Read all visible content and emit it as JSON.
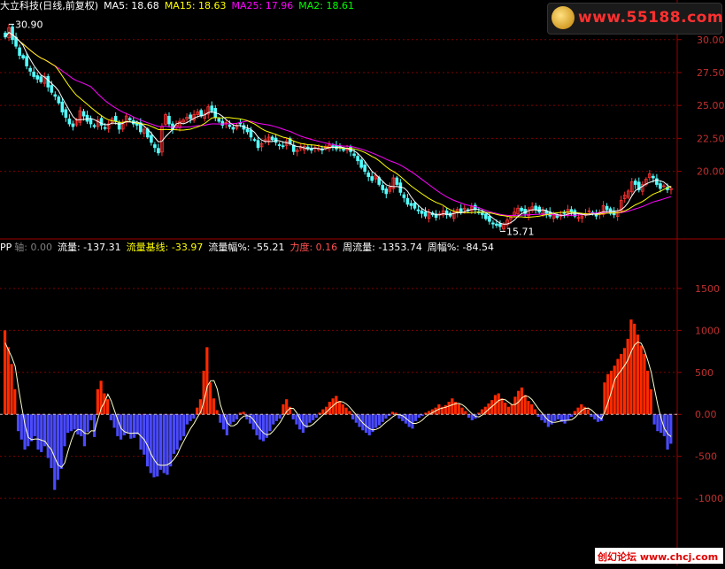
{
  "header_top": {
    "title": "大立科技(日线,前复权)",
    "ma5": "MA5: 18.68",
    "ma15": "MA15: 18.63",
    "ma25": "MA25: 17.96",
    "ma2": "MA2: 18.61"
  },
  "header_bottom": {
    "prefix": "PP",
    "axis": "轴: 0.00",
    "flow": "流量: -137.31",
    "flow_base": "流量基线: -33.97",
    "flow_amp": "流量幅%: -55.21",
    "force": "力度: 0.16",
    "week_flow": "周流量: -1353.74",
    "week_amp": "周幅%: -84.54"
  },
  "watermark_top": "www.55188.com",
  "watermark_bottom": "创幻论坛  www.chcj.com",
  "colors": {
    "up": "#ff3232",
    "down": "#54ffff",
    "ma5": "#ffffff",
    "ma15": "#ffff00",
    "ma25": "#ff00ff",
    "pos_bar": "#ff2a00",
    "neg_bar": "#4a4aff",
    "grid": "#800000",
    "axis_text": "#c03030"
  },
  "chart_data": [
    {
      "type": "candlestick",
      "title": "大立科技(日线,前复权)",
      "ylim": [
        15,
        32
      ],
      "yticks": [
        20.0,
        22.5,
        25.0,
        27.5,
        30.0
      ],
      "annotations": [
        {
          "label": "30.90",
          "value": 30.9
        },
        {
          "label": "15.71",
          "value": 15.71
        }
      ],
      "series": [
        {
          "name": "MA5",
          "last": 18.68
        },
        {
          "name": "MA15",
          "last": 18.63
        },
        {
          "name": "MA25",
          "last": 17.96
        },
        {
          "name": "MA2",
          "last": 18.61
        }
      ],
      "close": [
        30.2,
        30.9,
        30.0,
        29.5,
        28.8,
        28.6,
        28.0,
        27.6,
        27.2,
        27.0,
        26.8,
        27.2,
        26.4,
        26.0,
        25.7,
        25.2,
        24.5,
        24.1,
        23.6,
        23.4,
        23.9,
        24.6,
        24.2,
        23.8,
        23.6,
        23.4,
        23.9,
        23.5,
        23.3,
        23.6,
        24.0,
        23.8,
        23.2,
        23.6,
        24.2,
        23.9,
        23.6,
        23.5,
        23.0,
        23.2,
        22.6,
        22.2,
        21.8,
        21.4,
        23.4,
        24.3,
        23.6,
        23.2,
        23.5,
        23.8,
        23.9,
        24.1,
        24.0,
        24.3,
        24.5,
        24.2,
        24.4,
        24.9,
        24.6,
        24.1,
        23.8,
        23.5,
        23.7,
        23.4,
        23.2,
        23.5,
        23.6,
        23.2,
        23.0,
        22.6,
        22.4,
        21.8,
        22.1,
        22.4,
        22.6,
        22.4,
        22.2,
        22.0,
        21.9,
        22.3,
        22.1,
        21.5,
        21.6,
        21.8,
        21.9,
        21.7,
        21.6,
        21.8,
        21.7,
        21.6,
        21.9,
        22.0,
        21.9,
        21.7,
        21.8,
        21.6,
        21.7,
        21.5,
        21.2,
        20.8,
        20.3,
        20.0,
        19.6,
        19.3,
        19.7,
        19.0,
        18.6,
        18.3,
        18.8,
        19.5,
        19.0,
        18.4,
        18.0,
        17.5,
        17.4,
        17.2,
        17.0,
        16.8,
        16.6,
        16.9,
        16.7,
        16.5,
        16.8,
        17.0,
        16.7,
        16.6,
        16.9,
        17.1,
        16.9,
        17.2,
        17.0,
        17.3,
        17.1,
        16.9,
        16.7,
        16.4,
        16.2,
        16.0,
        15.9,
        15.8,
        16.0,
        16.3,
        16.5,
        16.9,
        17.2,
        17.0,
        16.8,
        17.1,
        17.3,
        17.1,
        16.9,
        17.0,
        16.8,
        16.6,
        16.7,
        16.5,
        16.7,
        16.8,
        17.1,
        16.9,
        16.6,
        16.5,
        16.6,
        16.8,
        17.0,
        16.8,
        16.6,
        16.9,
        17.4,
        17.1,
        16.8,
        16.7,
        17.0,
        17.8,
        18.2,
        18.5,
        19.2,
        19.0,
        18.6,
        19.0,
        19.4,
        19.8,
        19.5,
        19.0,
        18.7,
        18.9,
        18.6,
        18.7
      ]
    },
    {
      "type": "bar",
      "title": "PP",
      "ylim": [
        -1800,
        1900
      ],
      "yticks": [
        -1000,
        -500,
        0,
        500,
        1000,
        1500
      ],
      "series": [
        {
          "name": "流量",
          "last": -137.31
        },
        {
          "name": "流量基线",
          "last": -33.97
        },
        {
          "name": "流量幅%",
          "last": -55.21
        },
        {
          "name": "力度",
          "last": 0.16
        },
        {
          "name": "周流量",
          "last": -1353.74
        },
        {
          "name": "周幅%",
          "last": -84.54
        }
      ],
      "values": [
        1000,
        800,
        600,
        300,
        -200,
        -300,
        -420,
        -380,
        -320,
        -260,
        -420,
        -450,
        -380,
        -520,
        -640,
        -900,
        -780,
        -650,
        -380,
        -220,
        -200,
        -180,
        -240,
        -260,
        -380,
        -210,
        -70,
        -270,
        300,
        400,
        250,
        180,
        -70,
        -160,
        -260,
        -300,
        -250,
        -230,
        -290,
        -280,
        -240,
        -420,
        -480,
        -620,
        -700,
        -750,
        -740,
        -660,
        -700,
        -720,
        -620,
        -470,
        -420,
        -310,
        -260,
        -120,
        -80,
        -50,
        80,
        180,
        520,
        800,
        380,
        190,
        50,
        -100,
        -180,
        -250,
        -120,
        -90,
        -60,
        20,
        30,
        -60,
        -110,
        -180,
        -250,
        -300,
        -320,
        -280,
        -200,
        -120,
        -80,
        -50,
        120,
        180,
        90,
        -60,
        -120,
        -180,
        -220,
        -160,
        -100,
        -70,
        -40,
        20,
        60,
        90,
        150,
        190,
        220,
        160,
        120,
        80,
        40,
        -60,
        -100,
        -150,
        -190,
        -220,
        -250,
        -210,
        -160,
        -130,
        -90,
        -50,
        -20,
        30,
        20,
        -50,
        -80,
        -110,
        -150,
        -170,
        -80,
        -40,
        -20,
        20,
        40,
        60,
        80,
        120,
        90,
        110,
        150,
        190,
        150,
        120,
        80,
        40,
        -40,
        -70,
        -50,
        20,
        60,
        90,
        130,
        170,
        230,
        250,
        190,
        140,
        90,
        120,
        210,
        280,
        320,
        230,
        160,
        120,
        60,
        -30,
        -70,
        -100,
        -150,
        -120,
        -80,
        -60,
        -90,
        -110,
        -70,
        -30,
        40,
        80,
        120,
        90,
        60,
        -30,
        -60,
        -90,
        -80,
        380,
        480,
        520,
        580,
        660,
        720,
        790,
        900,
        1130,
        1080,
        950,
        820,
        720,
        520,
        300,
        -120,
        -200,
        -220,
        -260,
        -420,
        -350
      ]
    }
  ]
}
